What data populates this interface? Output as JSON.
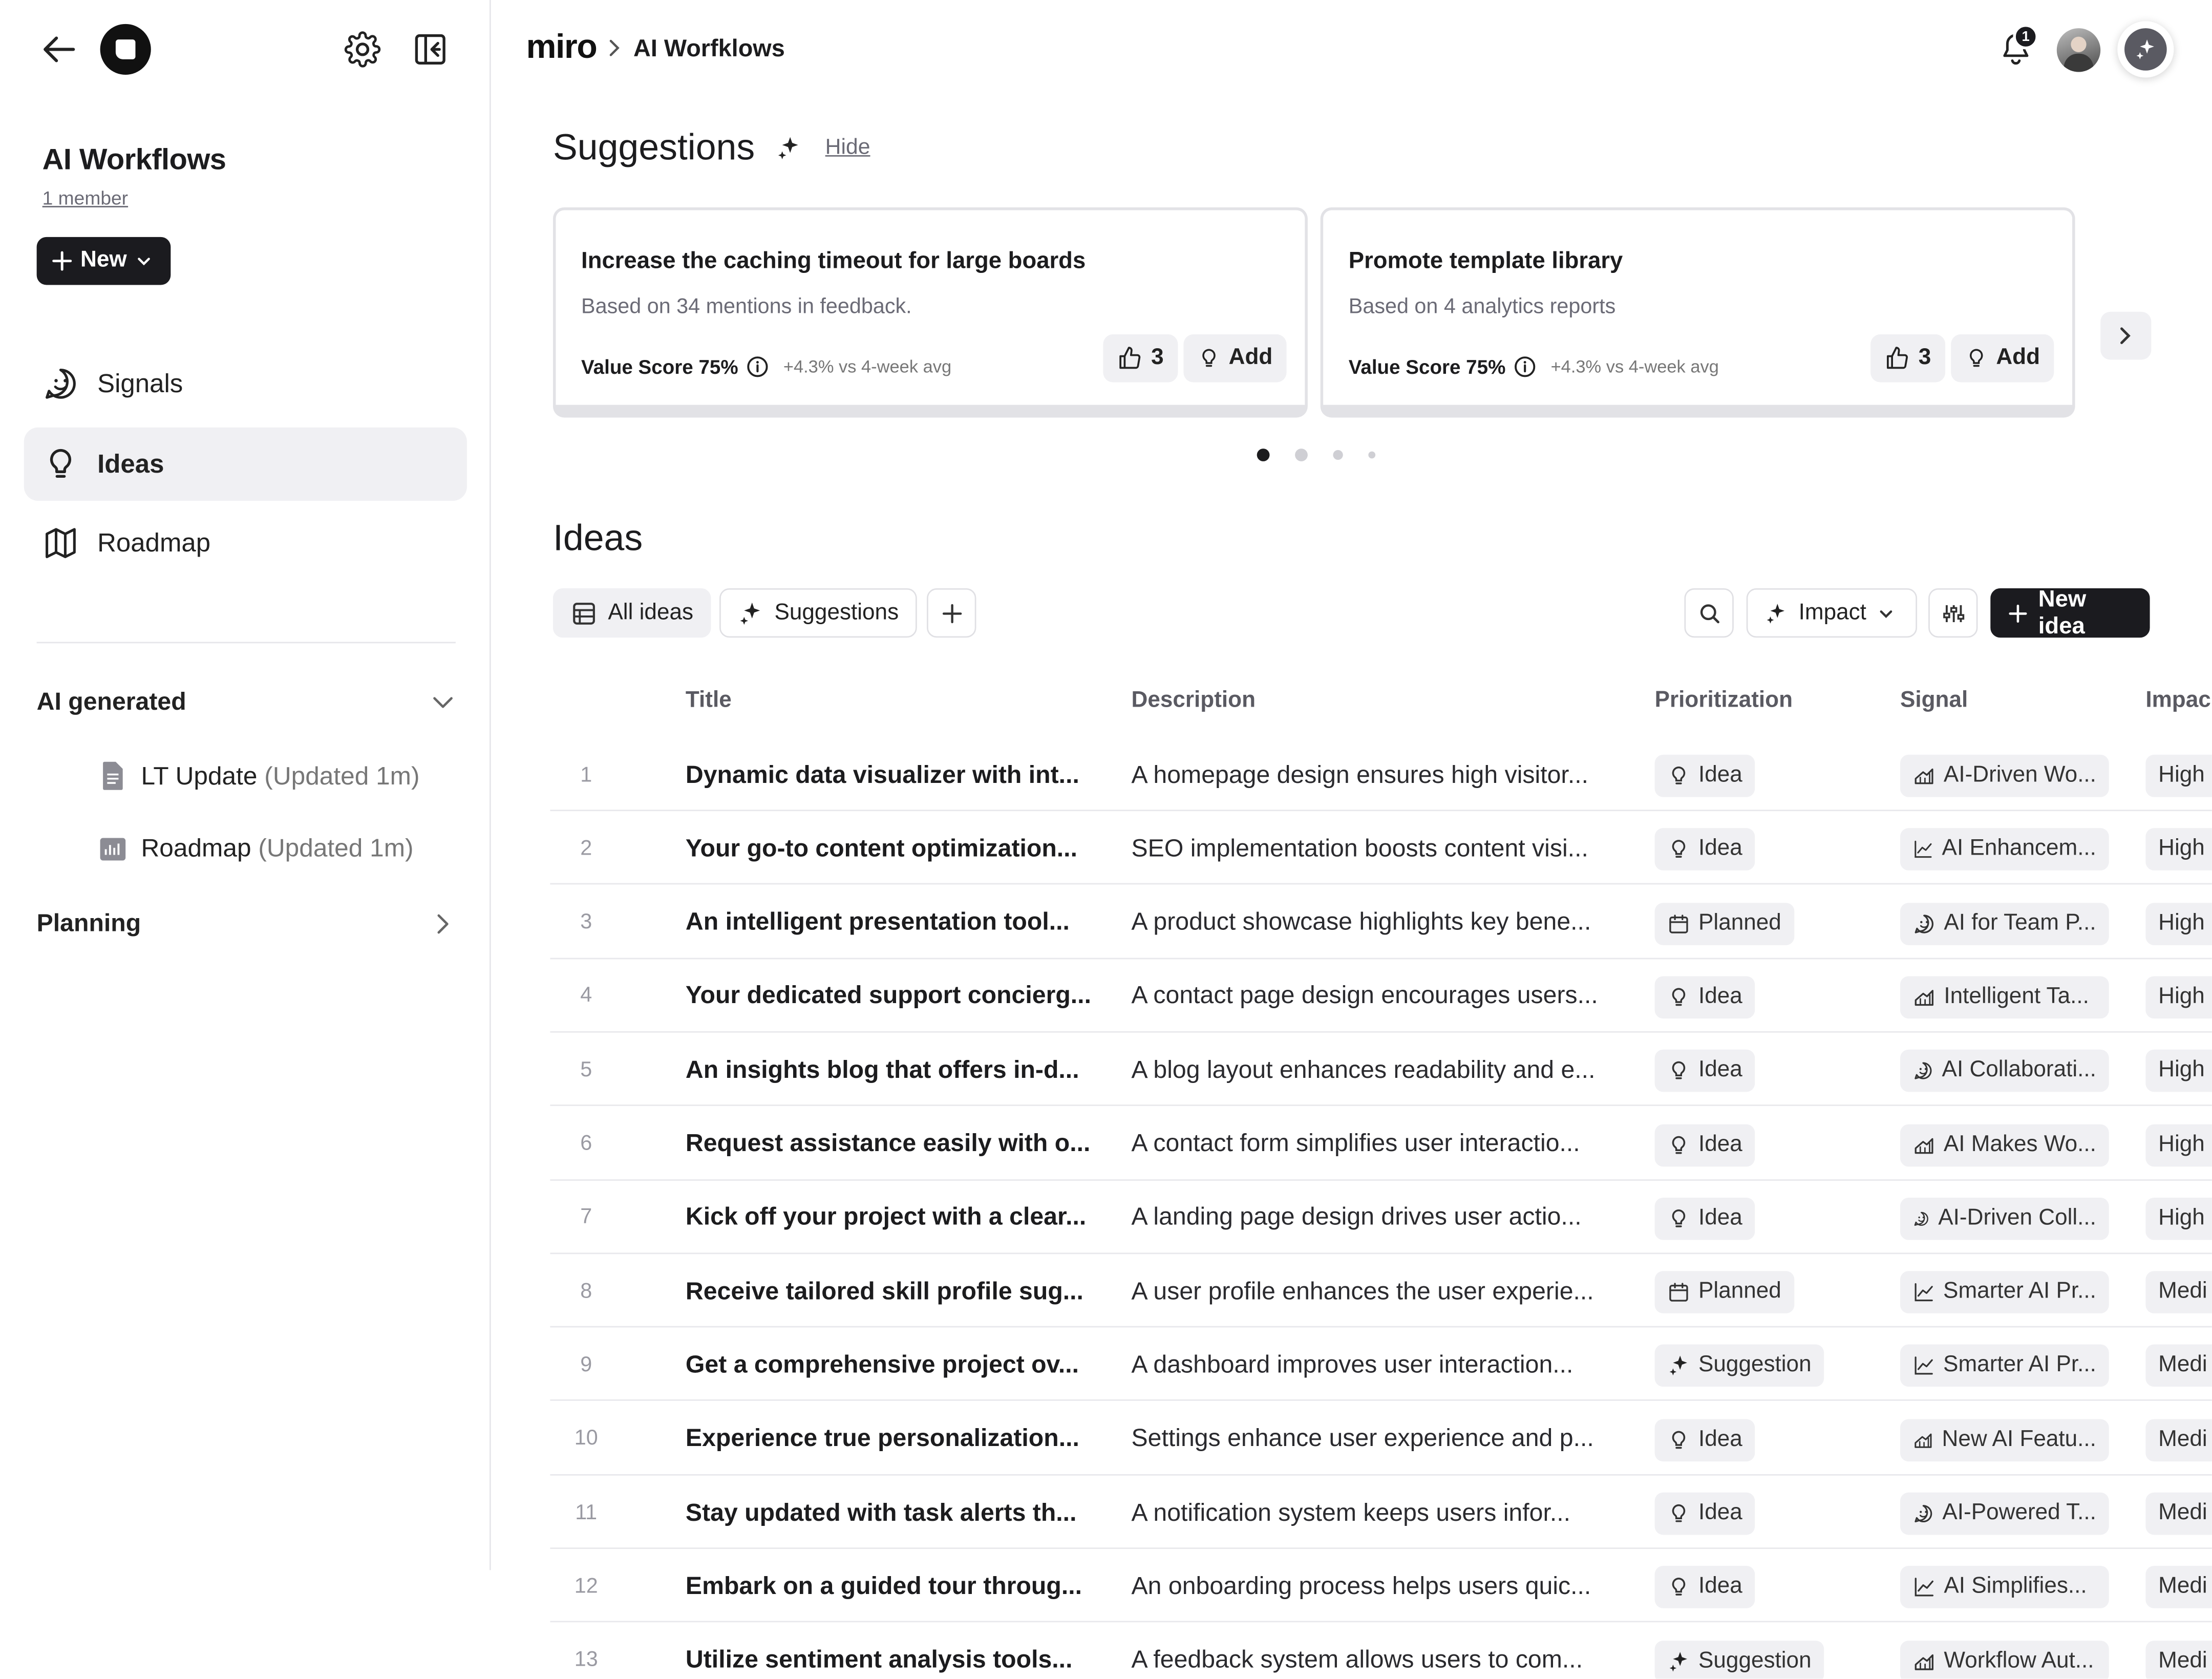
{
  "sidebar": {
    "board_title": "AI Workflows",
    "members": "1 member",
    "new_label": "New",
    "nav": [
      {
        "label": "Signals",
        "icon": "smiley-icon"
      },
      {
        "label": "Ideas",
        "icon": "lightbulb-icon",
        "active": true
      },
      {
        "label": "Roadmap",
        "icon": "map-icon"
      }
    ],
    "ai_generated": {
      "label": "AI generated",
      "items": [
        {
          "name": "LT Update",
          "meta": "(Updated 1m)",
          "icon": "document-icon"
        },
        {
          "name": "Roadmap",
          "meta": "(Updated 1m)",
          "icon": "presentation-icon"
        }
      ]
    },
    "planning": {
      "label": "Planning"
    }
  },
  "header": {
    "brand": "miro",
    "breadcrumb": "AI Worfklows",
    "notification_count": "1"
  },
  "suggestions": {
    "title": "Suggestions",
    "hide_label": "Hide",
    "cards": [
      {
        "title": "Increase the caching timeout for large boards",
        "subtitle": "Based on 34 mentions in feedback.",
        "value_score": "Value Score 75%",
        "delta": "+4.3% vs 4-week avg",
        "votes": "3",
        "add_label": "Add"
      },
      {
        "title": "Promote template library",
        "subtitle": "Based on 4 analytics reports",
        "value_score": "Value Score 75%",
        "delta": "+4.3% vs 4-week avg",
        "votes": "3",
        "add_label": "Add"
      }
    ],
    "page_count": 4,
    "active_page": 1
  },
  "ideas": {
    "title": "Ideas",
    "views": [
      {
        "label": "All ideas",
        "icon": "table-icon",
        "active": true
      },
      {
        "label": "Suggestions",
        "icon": "sparkle-icon",
        "active": false
      }
    ],
    "sort_label": "Impact",
    "new_idea_label": "New idea",
    "columns": {
      "title": "Title",
      "description": "Description",
      "prioritization": "Prioritization",
      "signal": "Signal",
      "impact": "Impac"
    },
    "rows": [
      {
        "num": "1",
        "title": "Dynamic data visualizer with int...",
        "description": "A homepage design ensures high visitor...",
        "prio": "Idea",
        "prio_icon": "lightbulb-icon",
        "signal": "AI-Driven Wo...",
        "signal_icon": "chart-area-icon",
        "impact": "High"
      },
      {
        "num": "2",
        "title": "Your go-to content optimization...",
        "description": "SEO implementation boosts content visi...",
        "prio": "Idea",
        "prio_icon": "lightbulb-icon",
        "signal": "AI Enhancem...",
        "signal_icon": "line-chart-icon",
        "impact": "High"
      },
      {
        "num": "3",
        "title": "An intelligent presentation tool...",
        "description": "A product showcase highlights key bene...",
        "prio": "Planned",
        "prio_icon": "calendar-icon",
        "signal": "AI for Team P...",
        "signal_icon": "smiley-icon",
        "impact": "High"
      },
      {
        "num": "4",
        "title": "Your dedicated support concierg...",
        "description": "A contact page design encourages users...",
        "prio": "Idea",
        "prio_icon": "lightbulb-icon",
        "signal": "Intelligent Ta...",
        "signal_icon": "chart-area-icon",
        "impact": "High"
      },
      {
        "num": "5",
        "title": "An insights blog that offers in-d...",
        "description": "A blog layout enhances readability and e...",
        "prio": "Idea",
        "prio_icon": "lightbulb-icon",
        "signal": "AI Collaborati...",
        "signal_icon": "smiley-icon",
        "impact": "High"
      },
      {
        "num": "6",
        "title": "Request assistance easily with o...",
        "description": "A contact form simplifies user interactio...",
        "prio": "Idea",
        "prio_icon": "lightbulb-icon",
        "signal": "AI Makes Wo...",
        "signal_icon": "chart-area-icon",
        "impact": "High"
      },
      {
        "num": "7",
        "title": "Kick off your project with a clear...",
        "description": "A landing page design drives user actio...",
        "prio": "Idea",
        "prio_icon": "lightbulb-icon",
        "signal": "AI-Driven Coll...",
        "signal_icon": "smiley-icon",
        "impact": "High"
      },
      {
        "num": "8",
        "title": "Receive tailored skill profile sug...",
        "description": "A user profile enhances the user experie...",
        "prio": "Planned",
        "prio_icon": "calendar-icon",
        "signal": "Smarter AI Pr...",
        "signal_icon": "line-chart-icon",
        "impact": "Medi"
      },
      {
        "num": "9",
        "title": "Get a comprehensive project ov...",
        "description": "A dashboard improves user interaction...",
        "prio": "Suggestion",
        "prio_icon": "sparkle-icon",
        "signal": "Smarter AI Pr...",
        "signal_icon": "line-chart-icon",
        "impact": "Medi"
      },
      {
        "num": "10",
        "title": "Experience true personalization...",
        "description": "Settings enhance user experience and p...",
        "prio": "Idea",
        "prio_icon": "lightbulb-icon",
        "signal": "New AI Featu...",
        "signal_icon": "chart-area-icon",
        "impact": "Medi"
      },
      {
        "num": "11",
        "title": "Stay updated with task alerts th...",
        "description": "A notification system keeps users infor...",
        "prio": "Idea",
        "prio_icon": "lightbulb-icon",
        "signal": "AI-Powered T...",
        "signal_icon": "smiley-icon",
        "impact": "Medi"
      },
      {
        "num": "12",
        "title": "Embark on a guided tour throug...",
        "description": "An onboarding process helps users quic...",
        "prio": "Idea",
        "prio_icon": "lightbulb-icon",
        "signal": "AI Simplifies...",
        "signal_icon": "line-chart-icon",
        "impact": "Medi"
      },
      {
        "num": "13",
        "title": "Utilize sentiment analysis tools...",
        "description": "A feedback system allows users to com...",
        "prio": "Suggestion",
        "prio_icon": "sparkle-icon",
        "signal": "Workflow Aut...",
        "signal_icon": "chart-area-icon",
        "impact": "Medi"
      }
    ]
  }
}
